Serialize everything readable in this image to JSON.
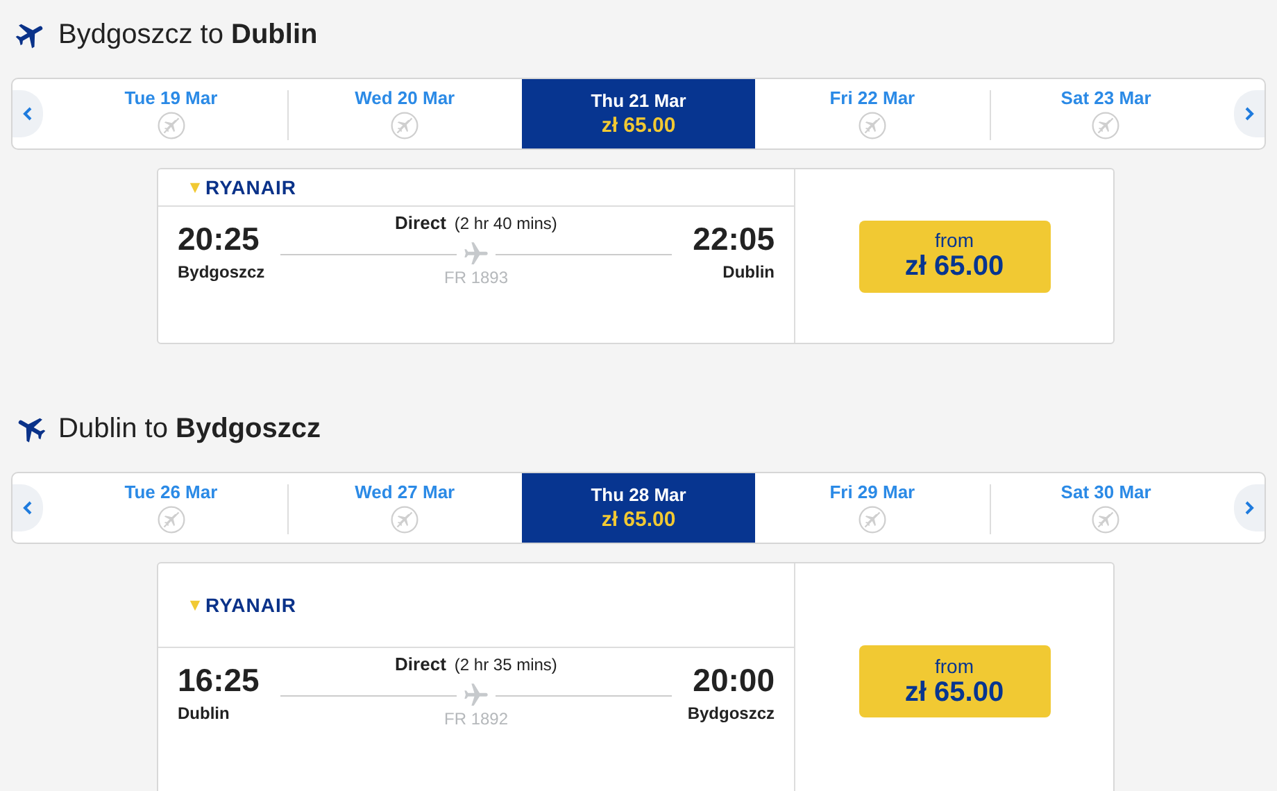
{
  "journeys": [
    {
      "kind": "outbound",
      "heading": "Bydgoszcz to **Dublin**",
      "dates": [
        {
          "label": "Tue 19 Mar",
          "selected": false
        },
        {
          "label": "Wed 20 Mar",
          "selected": false
        },
        {
          "label": "Thu 21 Mar",
          "price": "zł 65.00",
          "selected": true
        },
        {
          "label": "Fri 22 Mar",
          "selected": false
        },
        {
          "label": "Sat 23 Mar",
          "selected": false
        }
      ],
      "flight": {
        "airline": "RYANAIR",
        "type": "Direct",
        "duration": "(2 hr 40 mins)",
        "depart_time": "20:25",
        "depart_city": "Bydgoszcz",
        "arrive_time": "22:05",
        "arrive_city": "Dublin",
        "flight_number": "FR 1893",
        "price_label": "from",
        "price": "zł 65.00"
      }
    },
    {
      "kind": "return",
      "heading": "Dublin to **Bydgoszcz**",
      "dates": [
        {
          "label": "Tue 26 Mar",
          "selected": false
        },
        {
          "label": "Wed 27 Mar",
          "selected": false
        },
        {
          "label": "Thu 28 Mar",
          "price": "zł 65.00",
          "selected": true
        },
        {
          "label": "Fri 29 Mar",
          "selected": false
        },
        {
          "label": "Sat 30 Mar",
          "selected": false
        }
      ],
      "flight": {
        "airline": "RYANAIR",
        "type": "Direct",
        "duration": "(2 hr 35 mins)",
        "depart_time": "16:25",
        "depart_city": "Dublin",
        "arrive_time": "20:00",
        "arrive_city": "Bydgoszcz",
        "flight_number": "FR 1892",
        "price_label": "from",
        "price": "zł 65.00"
      }
    }
  ]
}
